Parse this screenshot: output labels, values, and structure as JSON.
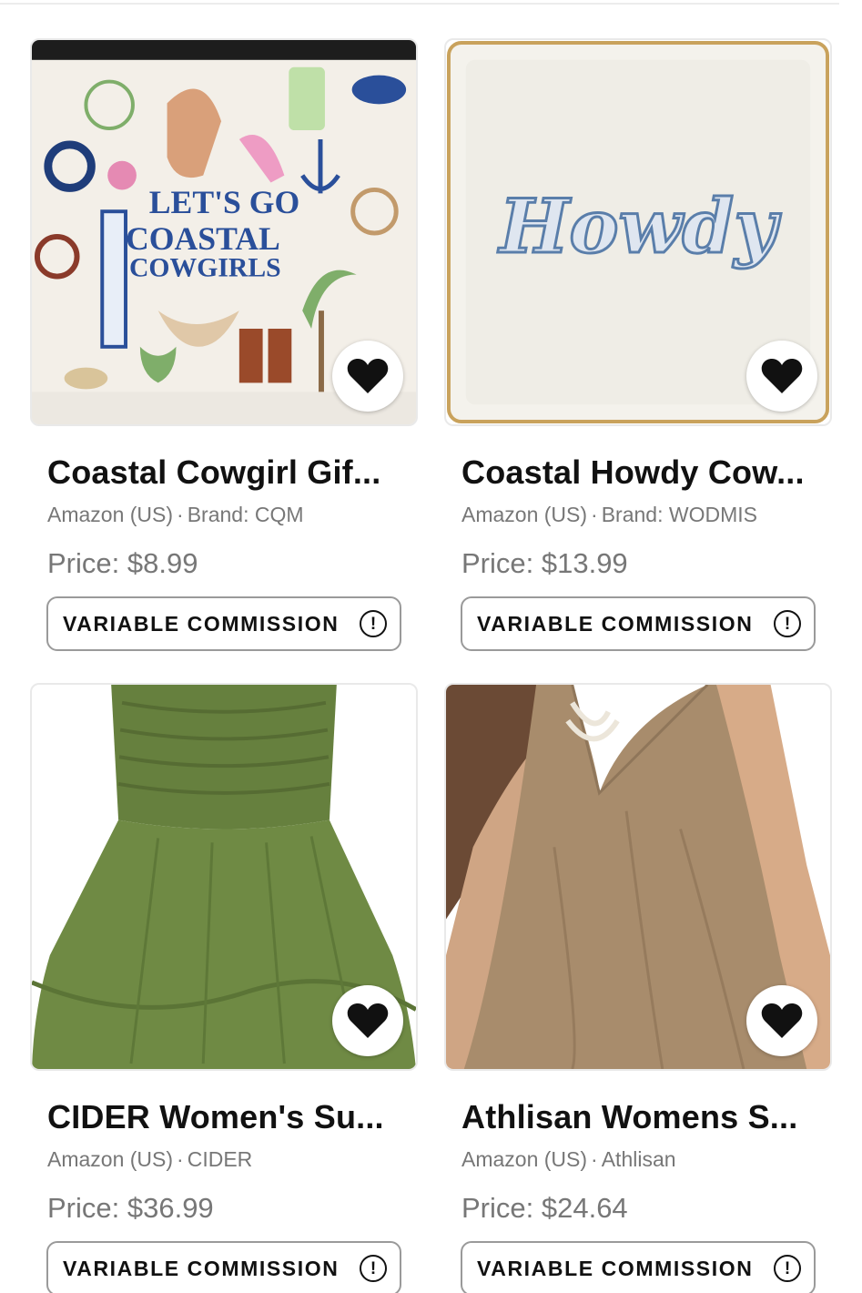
{
  "products": [
    {
      "title": "Coastal Cowgirl Gif...",
      "store": "Amazon (US)",
      "brand": "Brand: CQM",
      "price": "Price: $8.99",
      "commission_label": "VARIABLE COMMISSION",
      "image_text": [
        "LET'S GO",
        "COASTAL",
        "COWGIRLS"
      ]
    },
    {
      "title": "Coastal Howdy Cow...",
      "store": "Amazon (US)",
      "brand": "Brand: WODMIS",
      "price": "Price: $13.99",
      "commission_label": "VARIABLE COMMISSION",
      "image_text": [
        "Howdy"
      ]
    },
    {
      "title": "CIDER Women's Su...",
      "store": "Amazon (US)",
      "brand": "CIDER",
      "price": "Price: $36.99",
      "commission_label": "VARIABLE COMMISSION"
    },
    {
      "title": "Athlisan Womens S...",
      "store": "Amazon (US)",
      "brand": "Athlisan",
      "price": "Price: $24.64",
      "commission_label": "VARIABLE COMMISSION"
    }
  ],
  "separator": "·",
  "info_glyph": "!",
  "icons": {
    "favorite": "heart-icon",
    "info": "info-icon"
  },
  "colors": {
    "heart": "#111111",
    "border": "#9a9a9a",
    "muted_text": "#777777"
  }
}
